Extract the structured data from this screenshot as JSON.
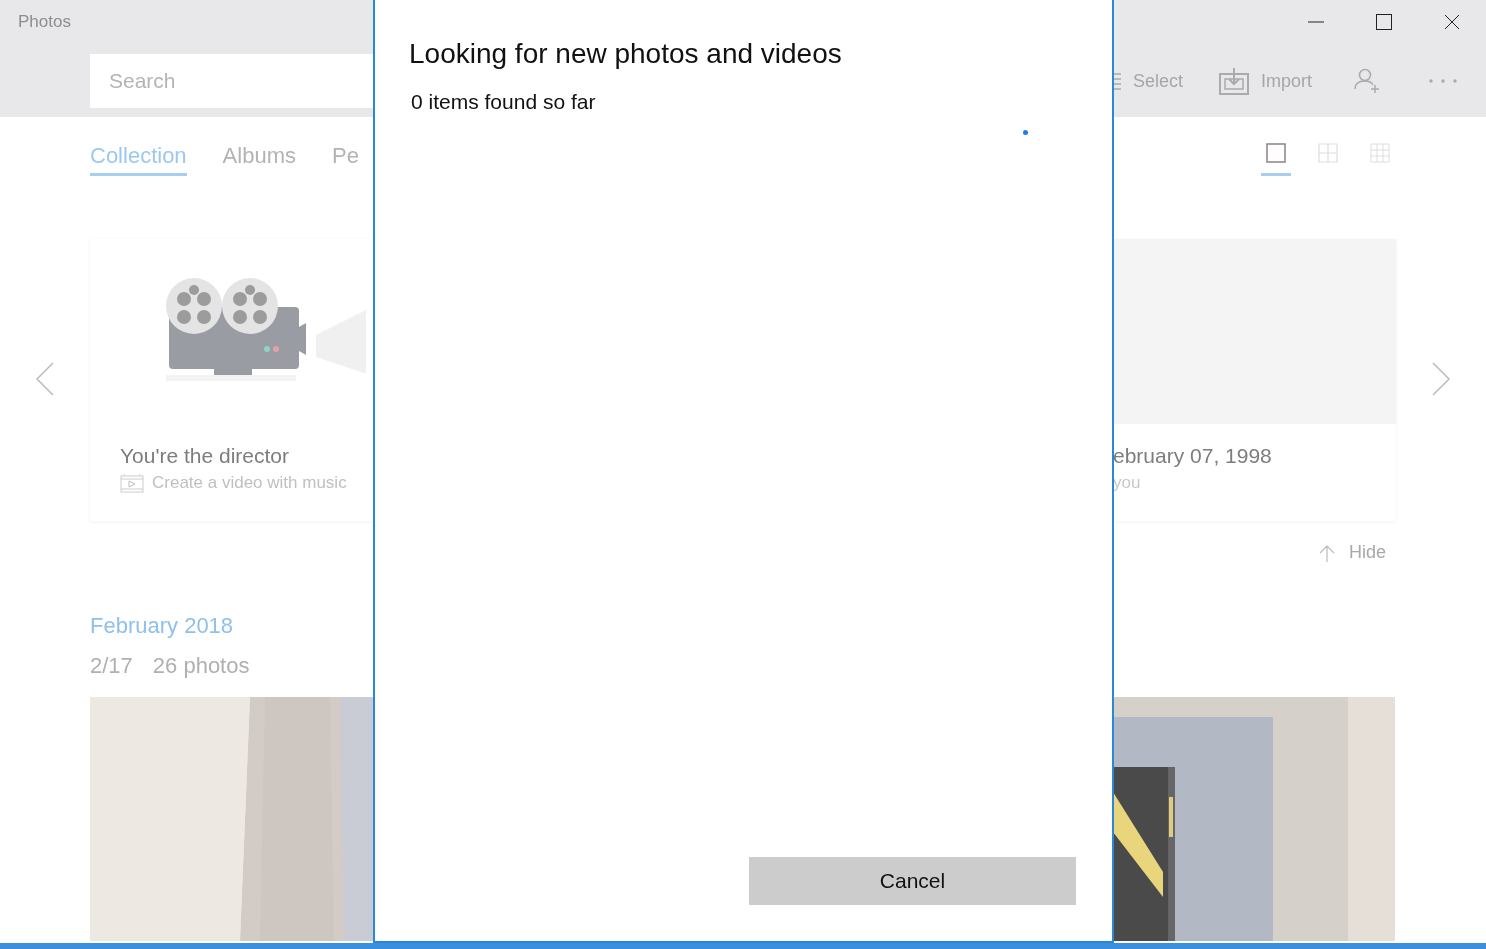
{
  "window": {
    "title": "Photos"
  },
  "search": {
    "placeholder": "Search"
  },
  "toolbar": [
    {
      "kind": "select",
      "label": "Select"
    },
    {
      "kind": "import",
      "label": "Import"
    },
    {
      "kind": "add-person"
    },
    {
      "kind": "more"
    }
  ],
  "tabs": [
    {
      "label": "Collection",
      "selected": true
    },
    {
      "label": "Albums",
      "selected": false
    },
    {
      "label": "Pe",
      "selected": false
    }
  ],
  "view_modes": [
    {
      "kind": "large",
      "selected": true
    },
    {
      "kind": "medium",
      "selected": false
    },
    {
      "kind": "small",
      "selected": false
    }
  ],
  "cards": [
    {
      "kind": "video",
      "title": "You're the director",
      "subtitle": "Create a video with music"
    },
    {
      "kind": "memory",
      "title": "ebruary 07, 1998",
      "subtitle": "you"
    }
  ],
  "hide": {
    "label": "Hide"
  },
  "section": {
    "heading": "February 2018",
    "date": "2/17",
    "count": "26 photos"
  },
  "dialog": {
    "title": "Looking for new photos and videos",
    "status": "0 items found so far",
    "button": "Cancel"
  }
}
